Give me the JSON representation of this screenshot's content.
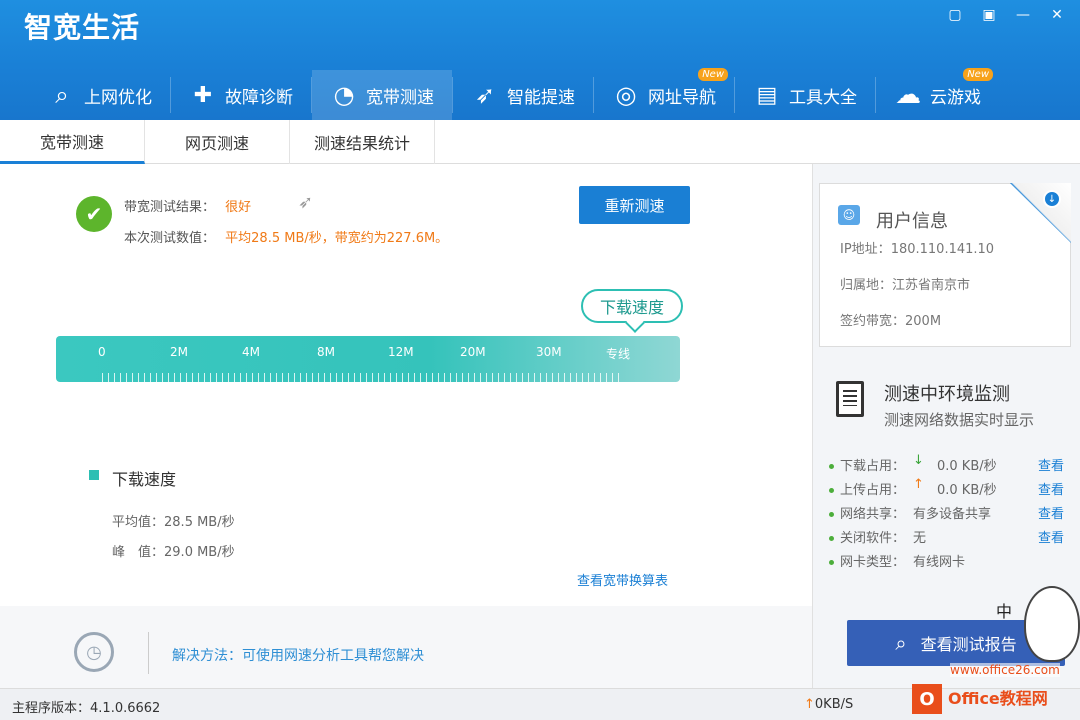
{
  "app": {
    "title": "智宽生活"
  },
  "window_controls": [
    {
      "name": "feedback-icon",
      "glyph": "▢"
    },
    {
      "name": "skin-icon",
      "glyph": "▣"
    },
    {
      "name": "minimize-icon",
      "glyph": "—"
    },
    {
      "name": "close-icon",
      "glyph": "✕"
    }
  ],
  "nav": {
    "items": [
      {
        "label": "上网优化",
        "icon": "search-icon",
        "glyph": "⌕"
      },
      {
        "label": "故障诊断",
        "icon": "shield-plus-icon",
        "glyph": "✚"
      },
      {
        "label": "宽带测速",
        "icon": "speedometer-icon",
        "glyph": "◔"
      },
      {
        "label": "智能提速",
        "icon": "rocket-icon",
        "glyph": "➶"
      },
      {
        "label": "网址导航",
        "icon": "compass-icon",
        "glyph": "◎"
      },
      {
        "label": "工具大全",
        "icon": "toolbox-icon",
        "glyph": "▤"
      },
      {
        "label": "云游戏",
        "icon": "cloud-game-icon",
        "glyph": "☁"
      }
    ],
    "active_index": 2,
    "badge_text": "New"
  },
  "subtabs": {
    "items": [
      "宽带测速",
      "网页测速",
      "测速结果统计"
    ],
    "active_index": 0
  },
  "result": {
    "label1": "带宽测试结果：",
    "value1": "很好",
    "label2": "本次测试数值：",
    "value2": "平均28.5 MB/秒，带宽约为227.6M。",
    "retest_button": "重新测速"
  },
  "gauge": {
    "bubble": "下载速度",
    "ticks": [
      "0",
      "2M",
      "4M",
      "8M",
      "12M",
      "20M",
      "30M",
      "专线"
    ]
  },
  "download": {
    "title": "下载速度",
    "avg_label": "平均值：",
    "avg_value": "28.5 MB/秒",
    "peak_label": "峰　值：",
    "peak_value": "29.0 MB/秒",
    "link": "查看宽带换算表"
  },
  "tip": {
    "text": "解决方法：可使用网速分析工具帮您解决"
  },
  "user_info": {
    "title": "用户信息",
    "ip_label": "IP地址：",
    "ip": "180.110.141.10",
    "loc_label": "归属地：",
    "loc": "江苏省南京市",
    "bw_label": "签约带宽：",
    "bw": "200M"
  },
  "monitor": {
    "title": "测速中环境监测",
    "subtitle": "测速网络数据实时显示",
    "rows": [
      {
        "label": "下载占用：",
        "value": "0.0 KB/秒",
        "arrow": "↓",
        "link": "查看"
      },
      {
        "label": "上传占用：",
        "value": "0.0 KB/秒",
        "arrow": "↑",
        "link": "查看"
      },
      {
        "label": "网络共享：",
        "value": "有多设备共享",
        "arrow": "",
        "link": "查看"
      },
      {
        "label": "关闭软件：",
        "value": "无",
        "arrow": "",
        "link": "查看"
      },
      {
        "label": "网卡类型：",
        "value": "有线网卡",
        "arrow": "",
        "link": ""
      }
    ],
    "report_button": "查看测试报告",
    "mascot_text": "中"
  },
  "status": {
    "version_label": "主程序版本：",
    "version": "4.1.0.6662",
    "speed": "0KB/S"
  },
  "watermark": {
    "brand": "Office教程网",
    "url": "www.office26.com"
  }
}
